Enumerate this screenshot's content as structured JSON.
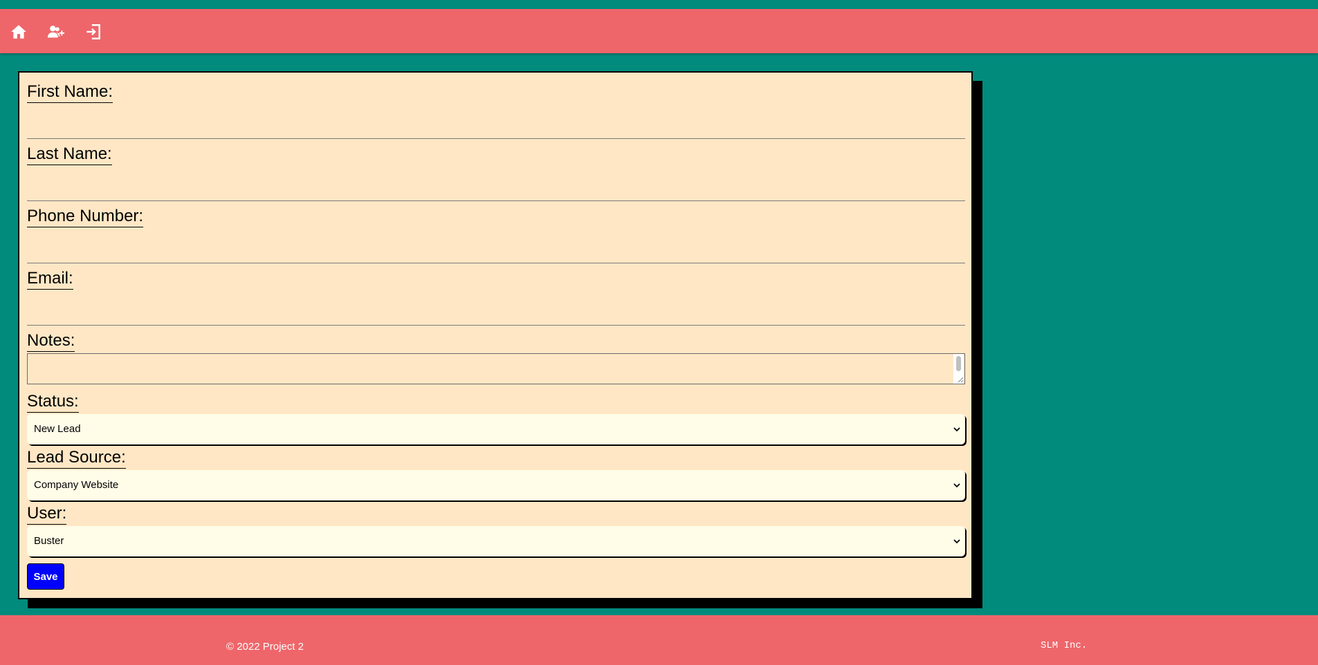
{
  "nav": {
    "icons": [
      "home-icon",
      "add-user-icon",
      "sign-out-icon"
    ]
  },
  "form": {
    "first_name_label": "First Name:",
    "last_name_label": "Last Name:",
    "phone_label": "Phone Number:",
    "email_label": "Email:",
    "notes_label": "Notes:",
    "status_label": "Status:",
    "status_value": "New Lead",
    "lead_source_label": "Lead Source:",
    "lead_source_value": "Company Website",
    "user_label": "User:",
    "user_value": "Buster",
    "save_label": "Save"
  },
  "footer": {
    "copyright": "© 2022 Project 2",
    "company": "SLM Inc."
  },
  "colors": {
    "background": "#008b7d",
    "bar": "#ee666a",
    "card": "#ffe7c5",
    "select_bg": "#fffde8",
    "save_button": "#0000ff"
  }
}
